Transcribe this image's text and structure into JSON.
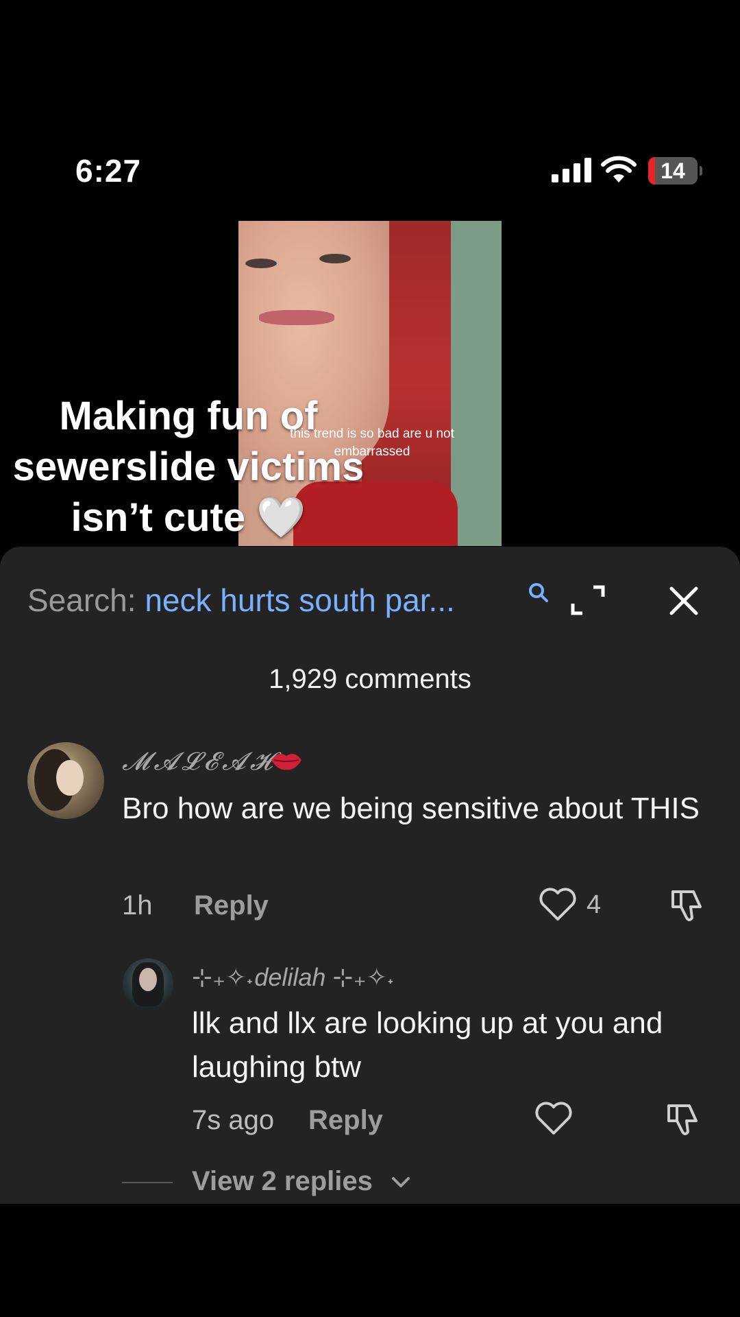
{
  "status_bar": {
    "time": "6:27",
    "battery": "14",
    "battery_level_percent": 14
  },
  "video": {
    "overlay_text": "Making fun of sewerslide victims isn’t cute 🤍",
    "caption": "this trend is so bad are u not embarrassed"
  },
  "search": {
    "prefix": "Search: ",
    "query": "neck hurts south par..."
  },
  "comments_header": {
    "count_label": "1,929 comments"
  },
  "comments": [
    {
      "username": "𝓜𝓐𝓛𝓔𝓐𝓗",
      "text": "Bro how are we being sensitive about THIS",
      "time": "1h",
      "reply_label": "Reply",
      "likes": "4"
    },
    {
      "username": "⊹₊✧˖delilah ⊹₊✧˖",
      "text": "llk and llx are looking up at you and laughing btw",
      "time": "7s ago",
      "reply_label": "Reply",
      "likes": ""
    }
  ],
  "view_replies": "View 2 replies",
  "colors": {
    "accent_link": "#79b1ff",
    "panel_bg": "#232323",
    "battery_low": "#e5252a"
  }
}
